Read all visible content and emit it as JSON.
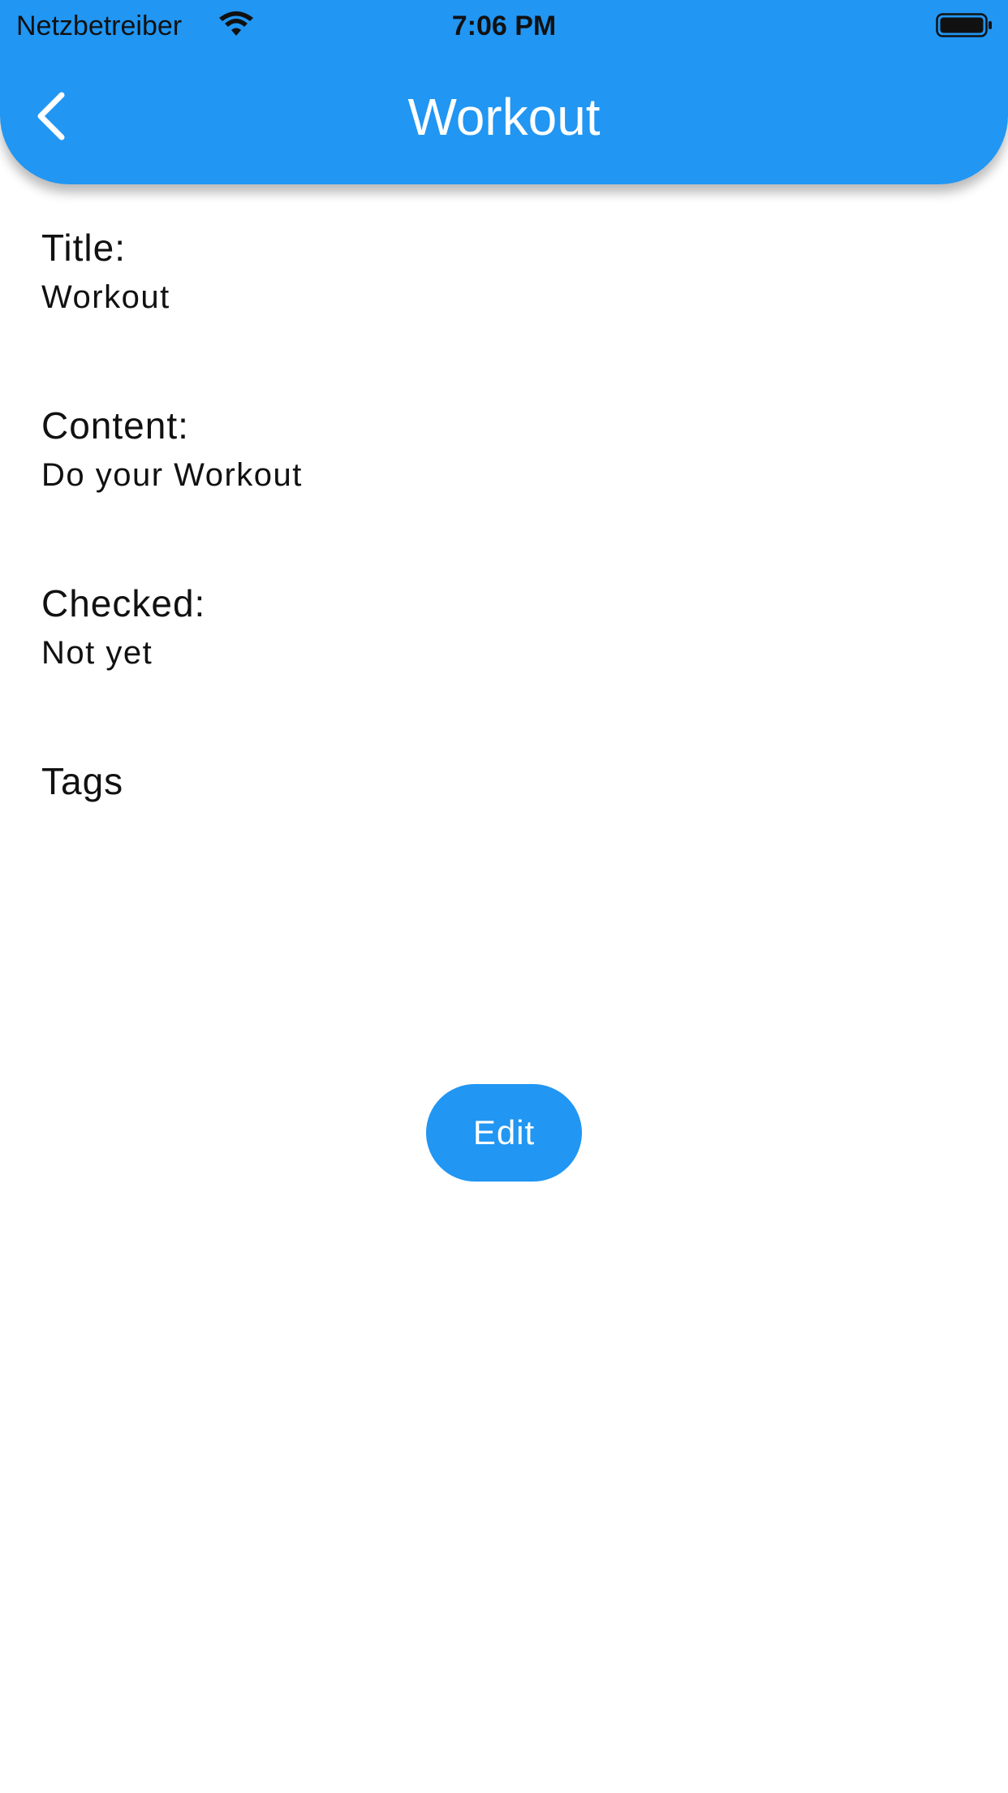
{
  "status_bar": {
    "carrier": "Netzbetreiber",
    "time": "7:06 PM",
    "wifi_icon": "wifi-icon",
    "battery_icon": "battery-icon"
  },
  "app_bar": {
    "title": "Workout",
    "back_icon": "chevron-left-icon",
    "color": "#2196f3"
  },
  "details": {
    "title_label": "Title:",
    "title_value": "Workout",
    "content_label": "Content:",
    "content_value": "Do your Workout",
    "checked_label": "Checked:",
    "checked_value": "Not yet",
    "tags_label": "Tags"
  },
  "actions": {
    "edit_label": "Edit"
  }
}
